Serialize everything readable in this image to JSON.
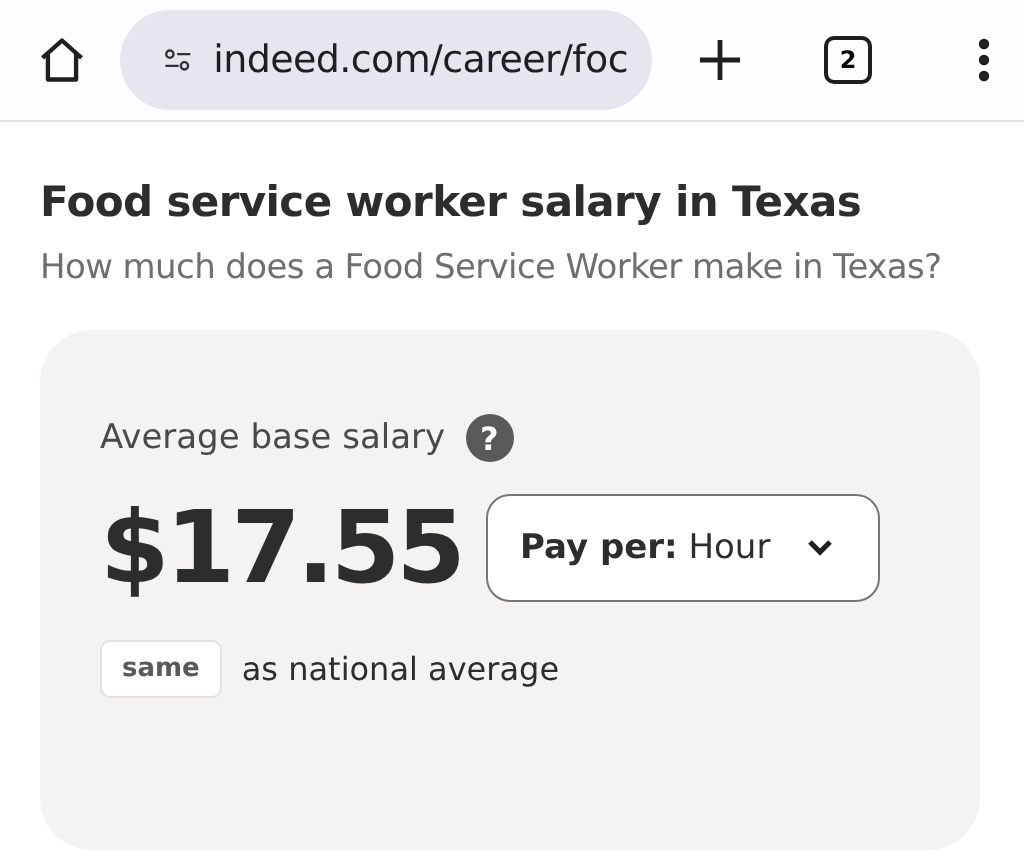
{
  "browser_bar": {
    "url": "indeed.com/career/foc",
    "tab_count": "2"
  },
  "page": {
    "title": "Food service worker salary in Texas",
    "subtitle": "How much does a Food Service Worker make in Texas?"
  },
  "salary_card": {
    "label": "Average base salary",
    "help_icon": "?",
    "amount": "$17.55",
    "pay_per": "**Pay per:** Hour",
    "comparison_badge": "same",
    "comparison_text": "as national average"
  }
}
